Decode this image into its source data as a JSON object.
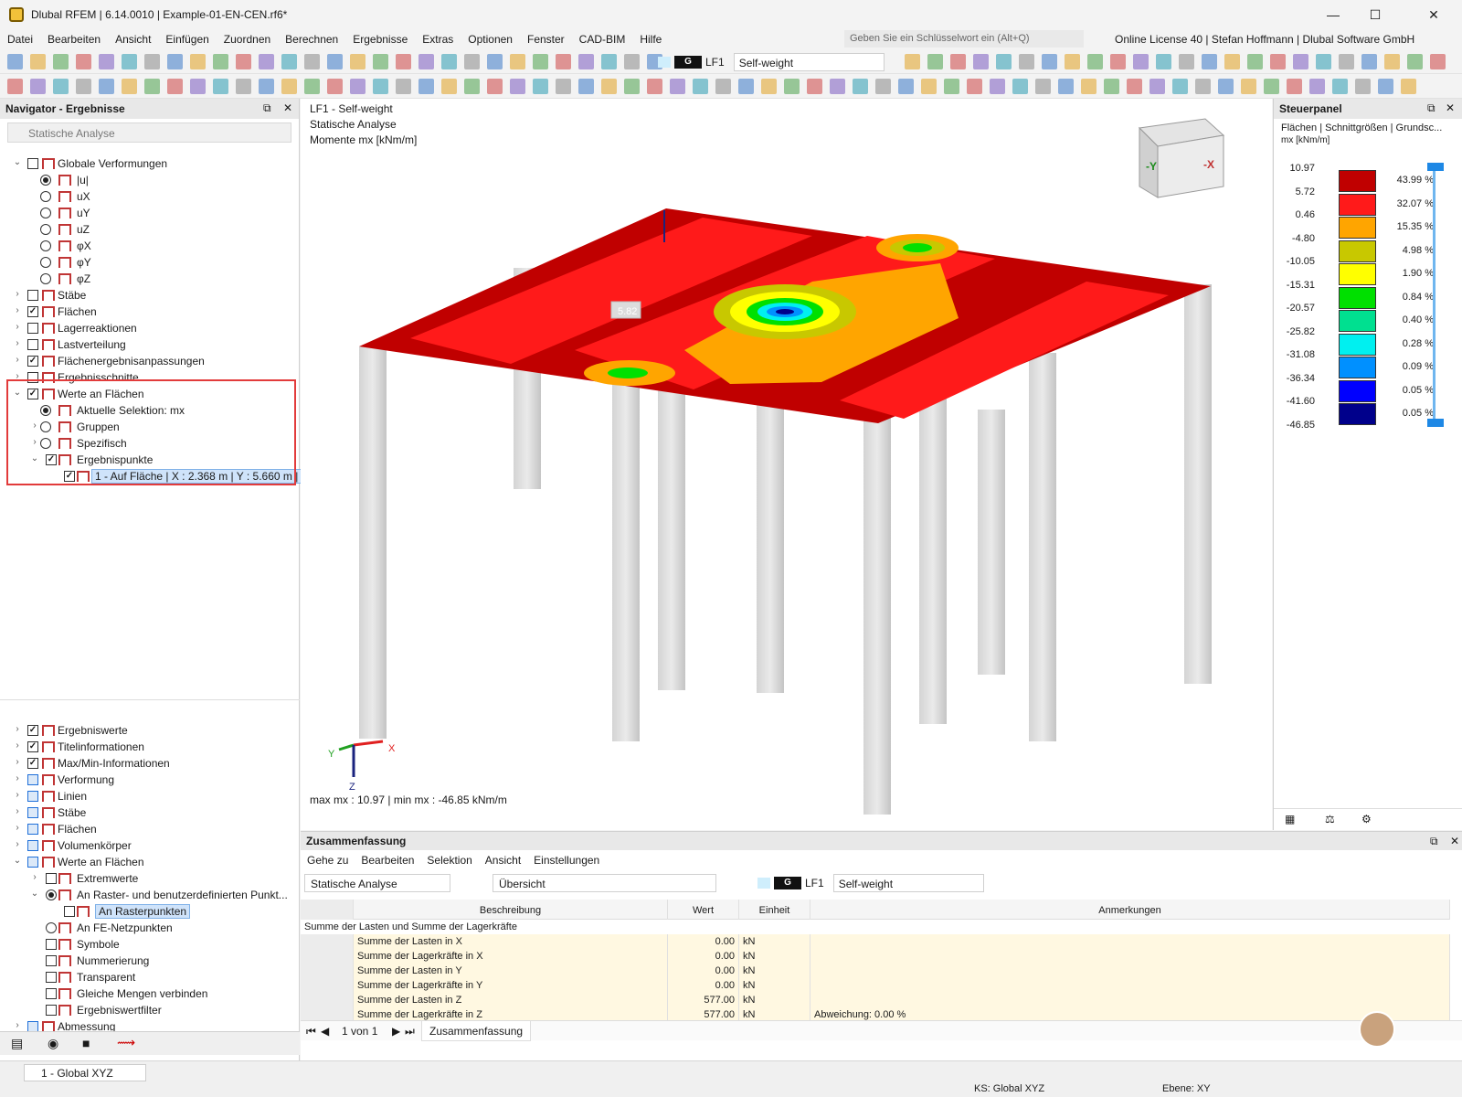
{
  "window": {
    "title": "Dlubal RFEM | 6.14.0010 | Example-01-EN-CEN.rf6*",
    "min": "—",
    "max": "☐",
    "close": "✕"
  },
  "menu": [
    "Datei",
    "Bearbeiten",
    "Ansicht",
    "Einfügen",
    "Zuordnen",
    "Berechnen",
    "Ergebnisse",
    "Extras",
    "Optionen",
    "Fenster",
    "CAD-BIM",
    "Hilfe"
  ],
  "search": {
    "placeholder": "Geben Sie ein Schlüsselwort ein (Alt+Q)"
  },
  "license": "Online License 40 | Stefan Hoffmann | Dlubal Software GmbH",
  "loadcase": {
    "tag": "G",
    "id": "LF1",
    "name": "Self-weight"
  },
  "navigator": {
    "title": "Navigator - Ergebnisse",
    "analysis": "Statische Analyse",
    "tree": [
      {
        "label": "Globale Verformungen",
        "check": "off"
      },
      {
        "label": "|u|",
        "radio": "on"
      },
      {
        "label": "uX",
        "radio": "off"
      },
      {
        "label": "uY",
        "radio": "off"
      },
      {
        "label": "uZ",
        "radio": "off"
      },
      {
        "label": "φX",
        "radio": "off"
      },
      {
        "label": "φY",
        "radio": "off"
      },
      {
        "label": "φZ",
        "radio": "off"
      },
      {
        "label": "Stäbe",
        "check": "off"
      },
      {
        "label": "Flächen",
        "check": "on"
      },
      {
        "label": "Lagerreaktionen",
        "check": "off"
      },
      {
        "label": "Lastverteilung",
        "check": "off"
      },
      {
        "label": "Flächenergebnisanpassungen",
        "check": "on"
      },
      {
        "label": "Ergebnisschnitte",
        "check": "off"
      },
      {
        "label": "Werte an Flächen",
        "check": "on"
      },
      {
        "label": "Aktuelle Selektion: mx",
        "radio": "on"
      },
      {
        "label": "Gruppen",
        "radio": "off"
      },
      {
        "label": "Spezifisch",
        "radio": "off"
      },
      {
        "label": "Ergebnispunkte",
        "check": "on"
      },
      {
        "label": "1 - Auf Fläche | X : 2.368 m | Y : 5.660 m | Z : ...",
        "check": "on"
      }
    ],
    "tree2": [
      {
        "label": "Ergebniswerte",
        "check": "on"
      },
      {
        "label": "Titelinformationen",
        "check": "on"
      },
      {
        "label": "Max/Min-Informationen",
        "check": "on"
      },
      {
        "label": "Verformung",
        "check": "part"
      },
      {
        "label": "Linien",
        "check": "part"
      },
      {
        "label": "Stäbe",
        "check": "part"
      },
      {
        "label": "Flächen",
        "check": "part"
      },
      {
        "label": "Volumenkörper",
        "check": "part"
      },
      {
        "label": "Werte an Flächen",
        "check": "part"
      },
      {
        "label": "Extremwerte",
        "check": "off"
      },
      {
        "label": "An Raster- und benutzerdefinierten Punkt...",
        "radio": "on"
      },
      {
        "label": "An Rasterpunkten",
        "check": "off"
      },
      {
        "label": "An FE-Netzpunkten",
        "radio": "off"
      },
      {
        "label": "Symbole",
        "check": "off"
      },
      {
        "label": "Nummerierung",
        "check": "off"
      },
      {
        "label": "Transparent",
        "check": "off"
      },
      {
        "label": "Gleiche Mengen verbinden",
        "check": "off"
      },
      {
        "label": "Ergebniswertfilter",
        "check": "off"
      },
      {
        "label": "Abmessung",
        "check": "part"
      }
    ]
  },
  "view": {
    "line1": "LF1 - Self-weight",
    "line2": "Statische Analyse",
    "line3": "Momente mx [kNm/m]",
    "footer": "max mx : 10.97 | min mx : -46.85 kNm/m",
    "probe": "5.82",
    "cube_y": "-Y",
    "cube_x": "-X",
    "axis_x": "X",
    "axis_y": "Y",
    "axis_z": "Z"
  },
  "control": {
    "title": "Steuerpanel",
    "sub1": "Flächen | Schnittgrößen | Grundsc...",
    "sub2": "mx [kNm/m]",
    "legend": [
      {
        "v": "10.97",
        "c": "#c00000",
        "p": "43.99 %"
      },
      {
        "v": "5.72",
        "c": "#ff1a1a",
        "p": "32.07 %"
      },
      {
        "v": "0.46",
        "c": "#ffa500",
        "p": "15.35 %"
      },
      {
        "v": "-4.80",
        "c": "#c8c800",
        "p": "4.98 %"
      },
      {
        "v": "-10.05",
        "c": "#ffff00",
        "p": "1.90 %"
      },
      {
        "v": "-15.31",
        "c": "#00e000",
        "p": "0.84 %"
      },
      {
        "v": "-20.57",
        "c": "#00e090",
        "p": "0.40 %"
      },
      {
        "v": "-25.82",
        "c": "#00f0f0",
        "p": "0.28 %"
      },
      {
        "v": "-31.08",
        "c": "#0090ff",
        "p": "0.09 %"
      },
      {
        "v": "-36.34",
        "c": "#0000ff",
        "p": "0.05 %"
      },
      {
        "v": "-41.60",
        "c": "#00008b",
        "p": "0.05 %"
      },
      {
        "v": "-46.85"
      }
    ]
  },
  "summary": {
    "title": "Zusammenfassung",
    "menu": [
      "Gehe zu",
      "Bearbeiten",
      "Selektion",
      "Ansicht",
      "Einstellungen"
    ],
    "combo1": "Statische Analyse",
    "combo2": "Übersicht",
    "columns": [
      "Beschreibung",
      "Wert",
      "Einheit",
      "Anmerkungen"
    ],
    "section": "Summe der Lasten und Summe der Lagerkräfte",
    "rows": [
      [
        "Summe der Lasten in X",
        "0.00",
        "kN",
        ""
      ],
      [
        "Summe der Lagerkräfte in X",
        "0.00",
        "kN",
        ""
      ],
      [
        "Summe der Lasten in Y",
        "0.00",
        "kN",
        ""
      ],
      [
        "Summe der Lagerkräfte in Y",
        "0.00",
        "kN",
        ""
      ],
      [
        "Summe der Lasten in Z",
        "577.00",
        "kN",
        ""
      ],
      [
        "Summe der Lagerkräfte in Z",
        "577.00",
        "kN",
        "Abweichung: 0.00 %"
      ]
    ],
    "pager": "1 von 1",
    "tab": "Zusammenfassung"
  },
  "status": {
    "cs": "1 - Global XYZ",
    "ks": "KS: Global XYZ",
    "plane": "Ebene: XY"
  }
}
